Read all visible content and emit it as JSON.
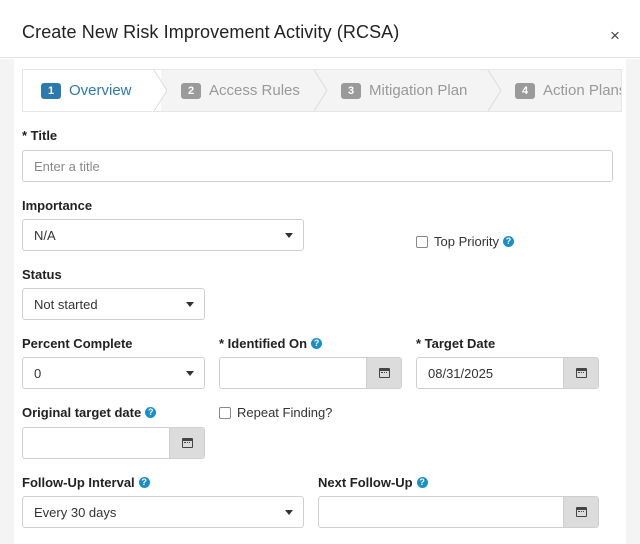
{
  "modal": {
    "title": "Create New Risk Improvement Activity (RCSA)",
    "close_glyph": "×"
  },
  "wizard": {
    "steps": [
      {
        "num": "1",
        "label": "Overview",
        "active": true
      },
      {
        "num": "2",
        "label": "Access Rules",
        "active": false
      },
      {
        "num": "3",
        "label": "Mitigation Plan",
        "active": false
      },
      {
        "num": "4",
        "label": "Action Plans",
        "active": false
      }
    ]
  },
  "form": {
    "title": {
      "label": "* Title",
      "placeholder": "Enter a title",
      "value": ""
    },
    "importance": {
      "label": "Importance",
      "value": "N/A"
    },
    "top_priority": {
      "label": "Top Priority",
      "checked": false
    },
    "status": {
      "label": "Status",
      "value": "Not started"
    },
    "percent_complete": {
      "label": "Percent Complete",
      "value": "0"
    },
    "identified_on": {
      "label": "* Identified On",
      "value": ""
    },
    "target_date": {
      "label": "* Target Date",
      "value": "08/31/2025"
    },
    "original_target_date": {
      "label": "Original target date",
      "value": ""
    },
    "repeat_finding": {
      "label": "Repeat Finding?",
      "checked": false
    },
    "follow_up_interval": {
      "label": "Follow-Up Interval",
      "value": "Every 30 days"
    },
    "next_follow_up": {
      "label": "Next Follow-Up",
      "value": ""
    }
  },
  "icons": {
    "help": "question-circle-icon",
    "calendar": "calendar-icon",
    "caret": "caret-down-icon"
  },
  "colors": {
    "accent": "#2a7ab0",
    "help": "#1a8fc7",
    "inactive_step": "#999999"
  }
}
